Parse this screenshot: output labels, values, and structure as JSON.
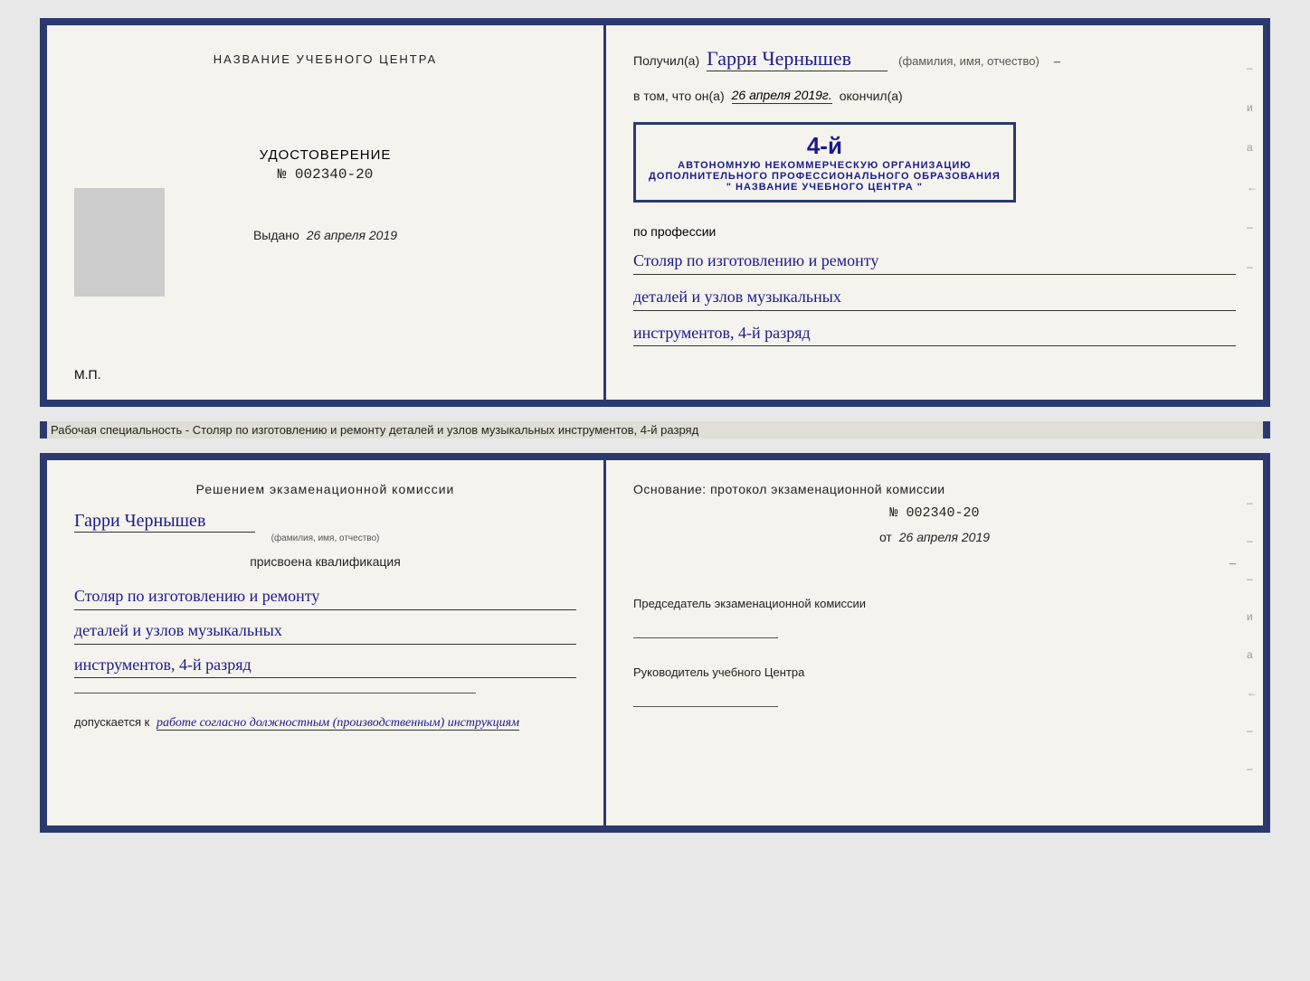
{
  "top_spread": {
    "left": {
      "center_title": "НАЗВАНИЕ УЧЕБНОГО ЦЕНТРА",
      "photo_alt": "photo",
      "certificate_label": "УДОСТОВЕРЕНИЕ",
      "certificate_number": "№ 002340-20",
      "vydano_prefix": "Выдано",
      "vydano_date": "26 апреля 2019",
      "mp_label": "М.П."
    },
    "right": {
      "poluchil_prefix": "Получил(а)",
      "recipient_name": "Гарри Чернышев",
      "fio_caption": "(фамилия, имя, отчество)",
      "v_tom_chto": "в том, что он(а)",
      "date_value": "26 апреля 2019г.",
      "okonchil": "окончил(а)",
      "stamp_line1": "4-й",
      "stamp_line2": "АВТОНОМНУЮ НЕКОММЕРЧЕСКУЮ ОРГАНИЗАЦИЮ",
      "stamp_line3": "ДОПОЛНИТЕЛЬНОГО ПРОФЕССИОНАЛЬНОГО ОБРАЗОВАНИЯ",
      "stamp_line4": "\" НАЗВАНИЕ УЧЕБНОГО ЦЕНТРА \"",
      "po_professii": "по профессии",
      "profession_line1": "Столяр по изготовлению и ремонту",
      "profession_line2": "деталей и узлов музыкальных",
      "profession_line3": "инструментов, 4-й разряд",
      "edge_letters": [
        "–",
        "и",
        "а",
        "←",
        "–",
        "–",
        "–",
        "–"
      ]
    }
  },
  "between_label": "Рабочая специальность - Столяр по изготовлению и ремонту деталей и узлов музыкальных инструментов, 4-й разряд",
  "bottom_spread": {
    "left": {
      "header": "Решением экзаменационной комиссии",
      "name": "Гарри Чернышев",
      "fio_caption": "(фамилия, имя, отчество)",
      "prisvoena": "присвоена квалификация",
      "qualification_line1": "Столяр по изготовлению и ремонту",
      "qualification_line2": "деталей и узлов музыкальных",
      "qualification_line3": "инструментов, 4-й разряд",
      "dopuskaetsya": "допускается к",
      "dopusk_value": "работе согласно должностным (производственным) инструкциям"
    },
    "right": {
      "osnovanie": "Основание: протокол экзаменационной комиссии",
      "number": "№ 002340-20",
      "ot_prefix": "от",
      "date": "26 апреля 2019",
      "predsedatel_label": "Председатель экзаменационной комиссии",
      "rukovoditel_label": "Руководитель учебного Центра",
      "edge_letters": [
        "–",
        "–",
        "–",
        "и",
        "а",
        "←",
        "–",
        "–",
        "–",
        "–"
      ]
    }
  }
}
